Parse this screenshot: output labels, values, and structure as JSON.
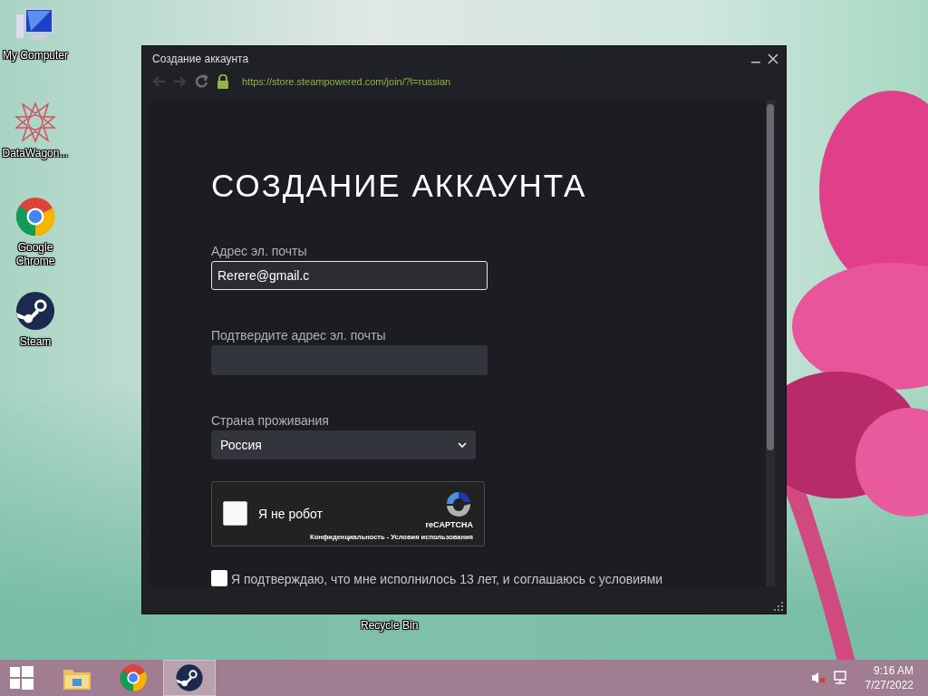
{
  "desktop_icons": [
    {
      "kind": "computer",
      "label": "My Computer"
    },
    {
      "kind": "star",
      "label": "DataWagon..."
    },
    {
      "kind": "chrome",
      "label": "Google Chrome"
    },
    {
      "kind": "steam",
      "label": "Steam"
    }
  ],
  "recycle_bin": {
    "label": "Recycle Bin"
  },
  "window": {
    "title": "Создание аккаунта",
    "url": "https://store.steampowered.com/join/?l=russian"
  },
  "page": {
    "heading": "СОЗДАНИЕ АККАУНТА",
    "fields": [
      {
        "label": "Адрес эл. почты",
        "value": "Rerere@gmail.c",
        "focused": true
      },
      {
        "label": "Подтвердите адрес эл. почты",
        "focused": false
      }
    ],
    "country": {
      "label": "Страна проживания",
      "value": "Россия"
    },
    "captcha": {
      "label": "Я не робот",
      "checked": false,
      "brand": "reCAPTCHA",
      "links": "Конфиденциальность - Условия использования"
    },
    "agree": {
      "text": "Я подтверждаю, что мне исполнилось 13 лет, и соглашаюсь с условиями",
      "checked": false
    }
  },
  "taskbar": {
    "apps": [
      {
        "kind": "explorer",
        "selected": false
      },
      {
        "kind": "chrome",
        "selected": false
      },
      {
        "kind": "steam",
        "selected": true
      }
    ],
    "time": "9:16 AM",
    "date": "7/27/2022"
  }
}
